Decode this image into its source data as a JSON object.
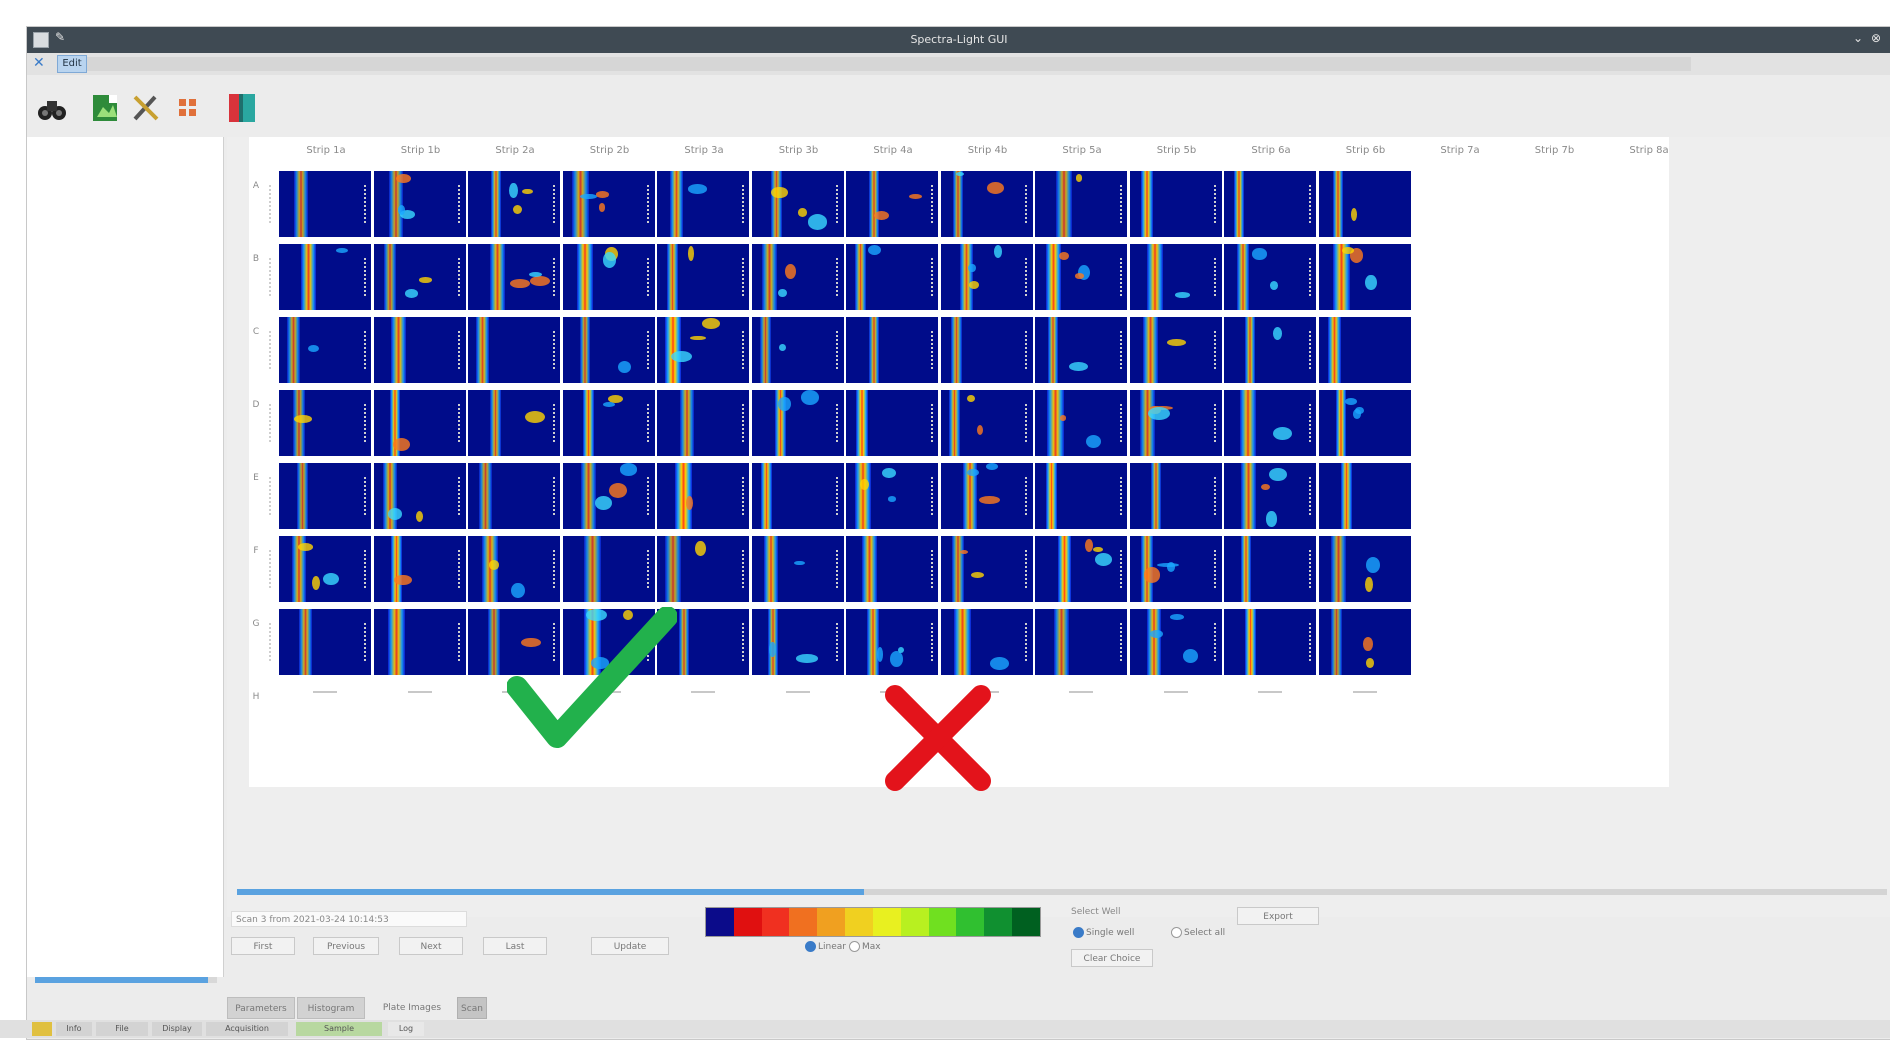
{
  "window": {
    "title": "Spectra-Light GUI"
  },
  "menubar": {
    "tab_label": "Edit"
  },
  "toolbar": {
    "tools": [
      {
        "name": "binoculars-icon"
      },
      {
        "name": "export-image-icon"
      },
      {
        "name": "tools-icon"
      },
      {
        "name": "grid-icon"
      },
      {
        "name": "book-icon"
      }
    ]
  },
  "plate": {
    "columns": [
      "Strip 1a",
      "Strip 1b",
      "Strip 2a",
      "Strip 2b",
      "Strip 3a",
      "Strip 3b",
      "Strip 4a",
      "Strip 4b",
      "Strip 5a",
      "Strip 5b",
      "Strip 6a",
      "Strip 6b",
      "Strip 7a",
      "Strip 7b",
      "Strip 8a"
    ],
    "rows": [
      "A",
      "B",
      "C",
      "D",
      "E",
      "F",
      "G",
      "H"
    ]
  },
  "controls": {
    "scan_info": "Scan 3 from 2021-03-24 10:14:53",
    "first_label": "First",
    "previous_label": "Previous",
    "next_label": "Next",
    "last_label": "Last",
    "update_label": "Update",
    "colorbar": {
      "colors": [
        "#0b0b8a",
        "#e01010",
        "#f03020",
        "#f07020",
        "#f0a020",
        "#f0d020",
        "#e8f020",
        "#b8f020",
        "#70e020",
        "#30c030",
        "#109030",
        "#006020"
      ],
      "labels": [
        "",
        "",
        "",
        "",
        "",
        "",
        "",
        "",
        "",
        "",
        "",
        ""
      ]
    },
    "radio_lin": "Linear",
    "radio_max": "Max",
    "select_well_label": "Select Well",
    "single_well_label": "Single well",
    "select_all_label": "Select all",
    "clear_choice_label": "Clear Choice",
    "export_label": "Export"
  },
  "tabs": {
    "items": [
      "Parameters",
      "Histogram",
      "Plate Images",
      "Scan"
    ],
    "active": "Plate Images"
  },
  "statusbar": {
    "items": [
      "Info",
      "File",
      "Display",
      "Acquisition",
      "Sample",
      "Log"
    ]
  },
  "colors": {
    "titlebar": "#3f4a53",
    "accent": "#5aa2e0",
    "heat_background": "#000c8a",
    "check_color": "#22b14c",
    "cross_color": "#e3131b"
  },
  "sidebar_progress": 0.95,
  "scroll_progress": 0.38
}
